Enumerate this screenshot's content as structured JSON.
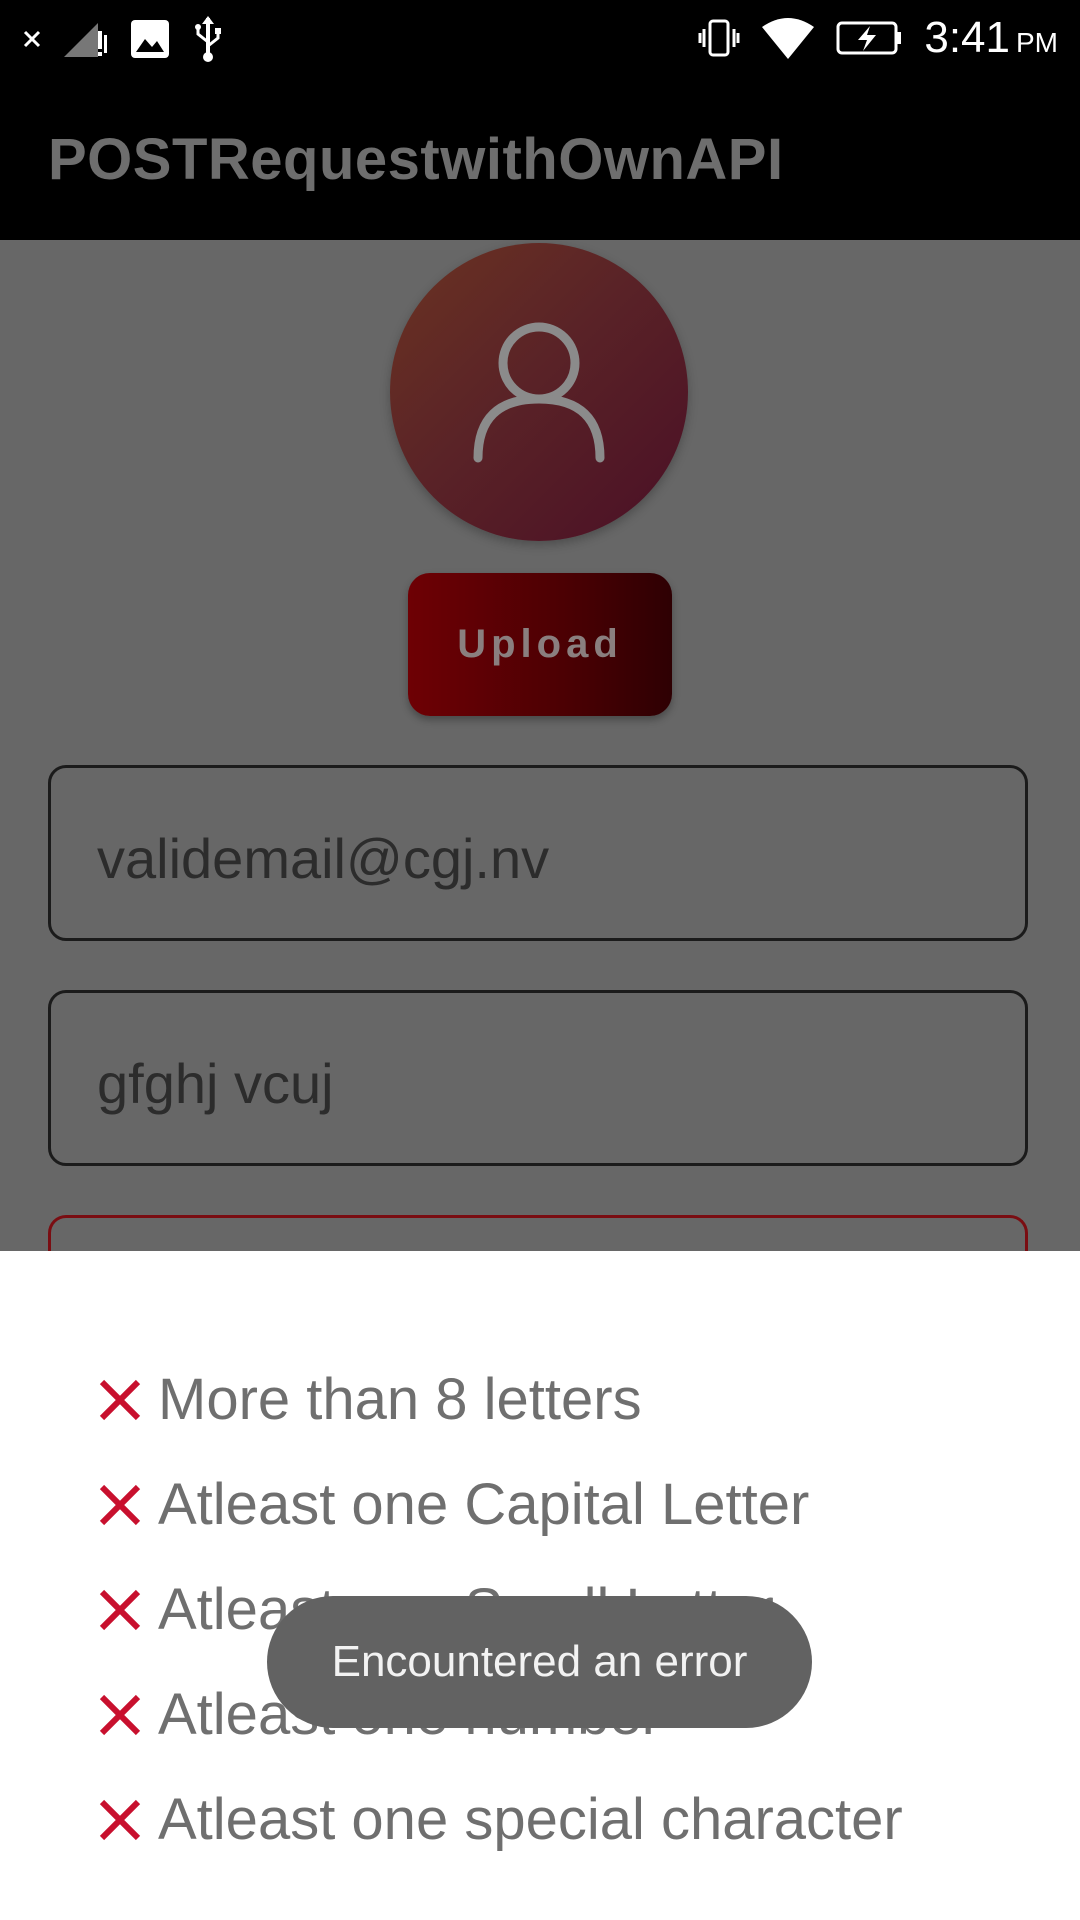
{
  "status_bar": {
    "time": "3:41",
    "ampm": "PM",
    "icons_left": [
      "close-icon",
      "signal-no-data-icon",
      "image-icon",
      "usb-icon"
    ],
    "icons_right": [
      "vibrate-icon",
      "wifi-icon",
      "battery-charging-icon"
    ]
  },
  "app_bar": {
    "title": "POSTRequestwithOwnAPI"
  },
  "profile": {
    "upload_label": "Upload"
  },
  "form": {
    "email_value": "validemail@cgj.nv",
    "name_value": "gfghj vcuj"
  },
  "password_requirements": {
    "items": [
      {
        "label": "More than 8 letters",
        "status": "unmet"
      },
      {
        "label": "Atleast one Capital Letter",
        "status": "unmet"
      },
      {
        "label": "Atleast one Small Letter",
        "status": "unmet"
      },
      {
        "label": "Atleast one number",
        "status": "unmet"
      },
      {
        "label": "Atleast one special character",
        "status": "unmet"
      }
    ]
  },
  "toast": {
    "message": "Encountered an error"
  },
  "colors": {
    "error_red": "#c8102e",
    "button_gradient_start": "#6e0004",
    "button_gradient_end": "#2e0003"
  }
}
